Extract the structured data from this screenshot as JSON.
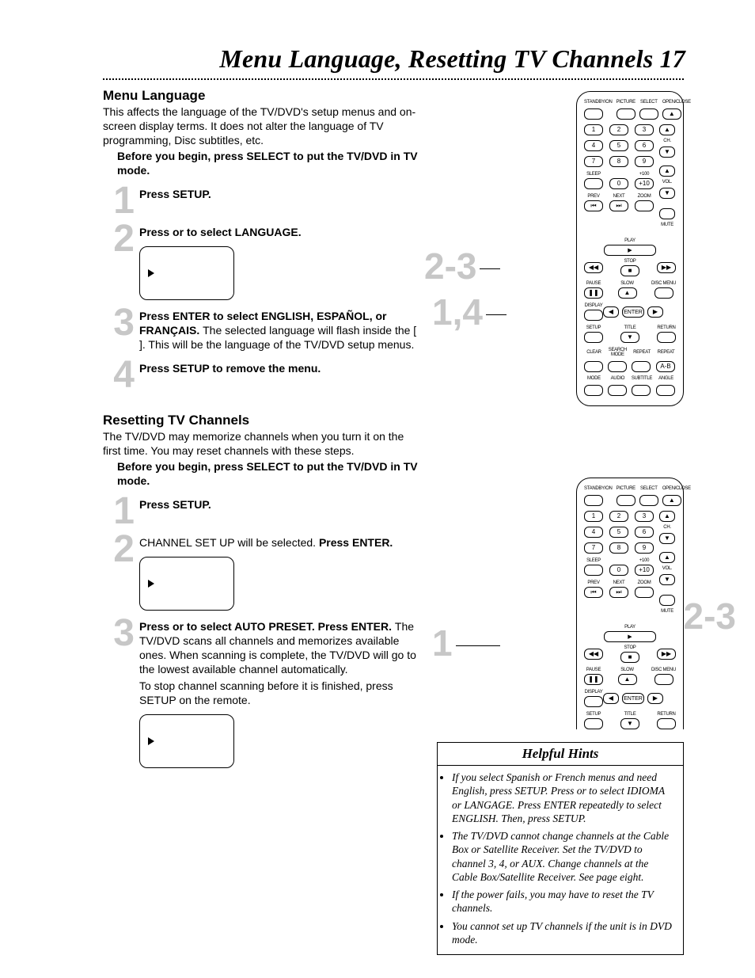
{
  "page": {
    "title": "Menu Language, Resetting TV Channels  17"
  },
  "menuLang": {
    "heading": "Menu Language",
    "intro": "This affects the language of the TV/DVD's setup menus and on-screen display terms. It does not alter the language of TV programming, Disc subtitles, etc.",
    "before": "Before you begin, press SELECT to put the TV/DVD in TV mode.",
    "steps": {
      "1": "Press SETUP.",
      "2": "Press      or      to select LANGUAGE.",
      "3a": "Press ENTER to select ENGLISH, ESPAÑOL, or FRANÇAIS. ",
      "3b": "The selected language will flash inside the [ ]. This will be the language of the TV/DVD setup menus.",
      "4": "Press SETUP to remove the menu."
    }
  },
  "reset": {
    "heading": "Resetting TV Channels",
    "intro": "The TV/DVD may memorize channels when you turn it on the first time. You may reset channels with these steps.",
    "before": "Before you begin, press SELECT to put the TV/DVD in TV mode.",
    "steps": {
      "1": "Press SETUP.",
      "2a": "CHANNEL SET UP will be selected. ",
      "2b": "Press ENTER.",
      "3a": "Press      or      to select AUTO PRESET. Press ENTER. ",
      "3b": "The TV/DVD scans all channels and memorizes available ones. When scanning is complete, the TV/DVD will go to the lowest available channel automatically.",
      "3c": "To stop channel scanning before it is finished, press SETUP on the remote."
    }
  },
  "callouts": {
    "r1a": "2-3",
    "r1b": "1,4",
    "r2a": "2-3",
    "r2b": "1"
  },
  "remote": {
    "topRow": [
      "STANDBY/ON",
      "PICTURE",
      "SELECT",
      "OPEN/CLOSE"
    ],
    "numrows": [
      [
        "1",
        "2",
        "3"
      ],
      [
        "4",
        "5",
        "6"
      ],
      [
        "7",
        "8",
        "9"
      ]
    ],
    "row3r": [
      "SLEEP",
      "0",
      "+100",
      "+10"
    ],
    "underNums": [
      "PREV",
      "NEXT",
      "ZOOM"
    ],
    "play": "PLAY",
    "stop": "STOP",
    "midL": "PAUSE",
    "midC": "SLOW",
    "midR": "DISC MENU",
    "disp": "DISPLAY",
    "enter": "ENTER",
    "setup": "SETUP",
    "title": "TITLE",
    "ret": "RETURN",
    "bottom1": [
      "CLEAR",
      "SEARCH MODE",
      "REPEAT",
      "REPEAT"
    ],
    "bottom2": [
      "MODE",
      "AUDIO",
      "SUBTITLE",
      "ANGLE"
    ],
    "ch": "CH.",
    "vol": "VOL.",
    "mute": "MUTE",
    "ab": "A-B"
  },
  "hints": {
    "heading": "Helpful Hints",
    "items": [
      "If you select Spanish or French menus and need English, press SETUP.  Press      or      to select IDIOMA or LANGAGE.  Press ENTER repeatedly to select ENGLISH. Then, press SETUP.",
      "The TV/DVD cannot change channels at the Cable Box or Satellite Receiver. Set the TV/DVD to channel 3, 4, or AUX. Change channels at the Cable Box/Satellite Receiver. See page eight.",
      "If the power fails, you may have to reset the TV channels.",
      "You cannot set up TV channels if the unit is in DVD mode."
    ]
  }
}
